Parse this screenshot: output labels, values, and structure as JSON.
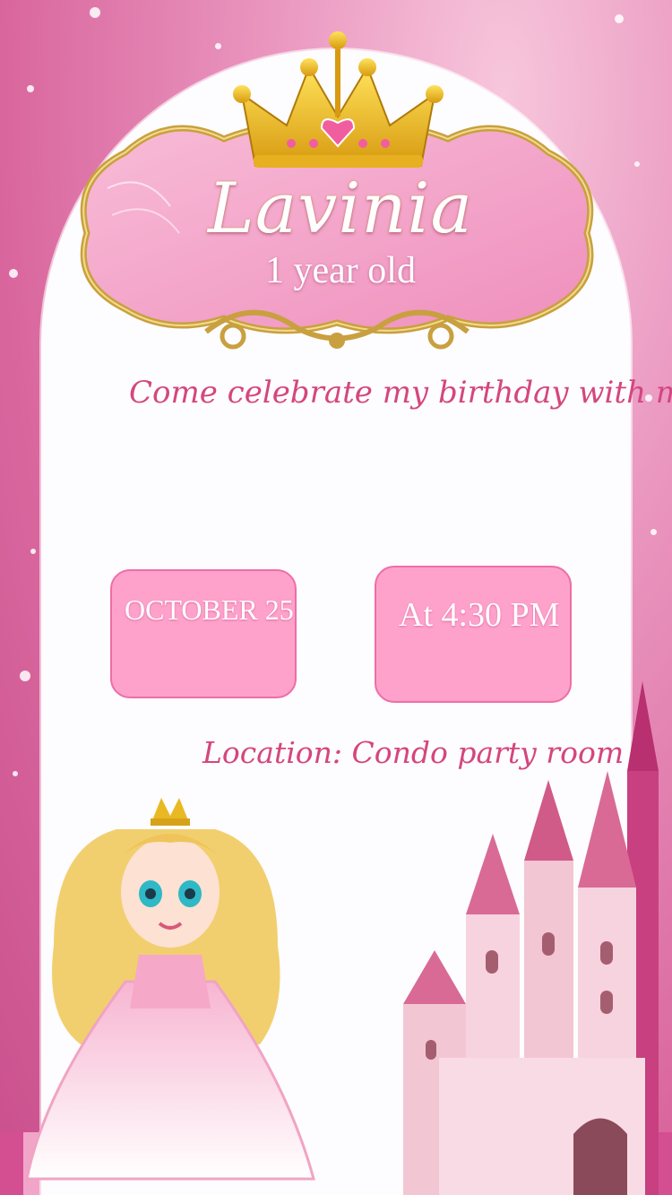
{
  "invitation": {
    "name": "Lavinia",
    "age_text": "1 year old",
    "message": "Come celebrate my birthday with me. You a",
    "date": "OCTOBER 25",
    "time": "At 4:30 PM",
    "location": "Location: Condo party room"
  },
  "icons": {
    "crown": "crown-icon",
    "frame": "ornate-frame",
    "castle": "castle-illustration",
    "princess": "princess-illustration"
  },
  "colors": {
    "background": "#e993bd",
    "card": "#fdfcfe",
    "accent_text": "#d4467e",
    "box_fill": "#fea2cc",
    "box_border": "#ee6ea6",
    "gold": "#e8b923"
  }
}
